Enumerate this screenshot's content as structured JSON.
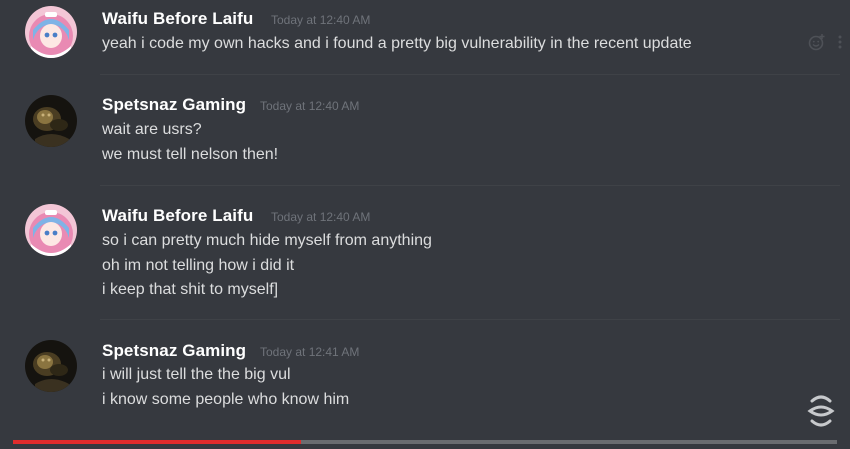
{
  "messages": [
    {
      "author": "Waifu Before Laifu",
      "timestamp": "Today at 12:40 AM",
      "avatar_icon": "anime-girl-avatar-icon",
      "lines": [
        "yeah i code my own hacks and i found a pretty big vulnerability in the recent update"
      ]
    },
    {
      "author": "Spetsnaz Gaming",
      "timestamp": "Today at 12:40 AM",
      "avatar_icon": "dark-soldier-avatar-icon",
      "lines": [
        "wait are usrs?",
        "we must tell nelson then!"
      ]
    },
    {
      "author": "Waifu Before Laifu",
      "timestamp": "Today at 12:40 AM",
      "avatar_icon": "anime-girl-avatar-icon",
      "lines": [
        "so i can pretty much hide myself from anything",
        "oh im not telling how i did it",
        "i keep that shit to myself]"
      ]
    },
    {
      "author": "Spetsnaz Gaming",
      "timestamp": "Today at 12:41 AM",
      "avatar_icon": "dark-soldier-avatar-icon",
      "lines": [
        "i will just tell the the big vul",
        "i know some people who know him"
      ]
    }
  ],
  "hover_actions": [
    "add-reaction-icon",
    "more-options-icon"
  ],
  "video": {
    "progress_fraction": 0.35,
    "watermark_icon": "channel-logo-icon"
  },
  "colors": {
    "background": "#36393f",
    "author": "#ffffff",
    "message_text": "#dcddde",
    "timestamp": "#6f737a",
    "progress": "#e02c2c"
  }
}
